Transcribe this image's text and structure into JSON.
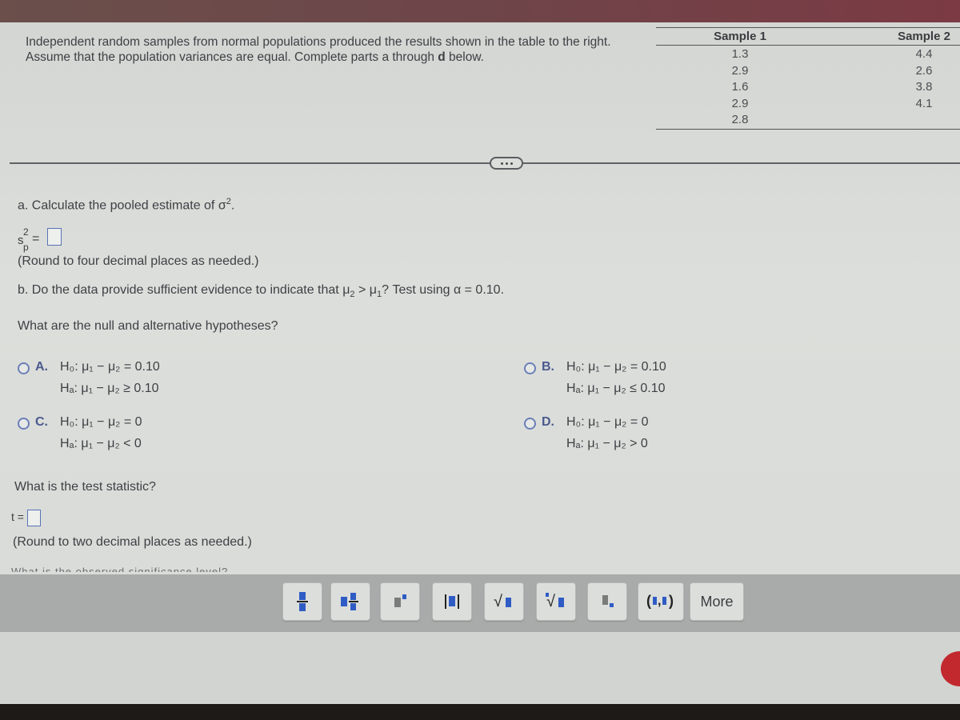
{
  "problem": {
    "line1": "Independent random samples from normal populations produced the results shown in the table to the right.",
    "line2_pre": "Assume that the population variances are equal. Complete parts a through ",
    "line2_bold": "d",
    "line2_post": " below."
  },
  "table": {
    "columns": [
      {
        "header": "Sample 1",
        "values": [
          "1.3",
          "2.9",
          "1.6",
          "2.9",
          "2.8"
        ]
      },
      {
        "header": "Sample 2",
        "values": [
          "4.4",
          "2.6",
          "3.8",
          "4.1"
        ]
      }
    ]
  },
  "part_a": {
    "prompt": "a. Calculate the pooled estimate of σ",
    "prompt_sup": "2",
    "prompt_end": ".",
    "answer_label_s": "s",
    "answer_label_sup": "2",
    "answer_label_sub": "p",
    "equals": "=",
    "answer_value": "",
    "hint": "(Round to four decimal places as needed.)"
  },
  "part_b": {
    "prompt_pre": "b. Do the data provide sufficient evidence to indicate that μ",
    "prompt_sub1": "2",
    "prompt_mid": " > μ",
    "prompt_sub2": "1",
    "prompt_post": "? Test using α = 0.10.",
    "hypotheses_question": "What are the null and alternative hypotheses?",
    "options": [
      {
        "letter": "A.",
        "h0": "H₀: μ₁ − μ₂ = 0.10",
        "ha": "Hₐ: μ₁ − μ₂ ≥ 0.10",
        "selected": false
      },
      {
        "letter": "B.",
        "h0": "H₀: μ₁ − μ₂ = 0.10",
        "ha": "Hₐ: μ₁ − μ₂ ≤ 0.10",
        "selected": false
      },
      {
        "letter": "C.",
        "h0": "H₀: μ₁ − μ₂ = 0",
        "ha": "Hₐ: μ₁ − μ₂ < 0",
        "selected": false
      },
      {
        "letter": "D.",
        "h0": "H₀: μ₁ − μ₂ = 0",
        "ha": "Hₐ: μ₁ − μ₂ > 0",
        "selected": false
      }
    ],
    "test_stat_question": "What is the test statistic?",
    "t_label": "t =",
    "t_value": "",
    "t_hint": "(Round to two decimal places as needed.)",
    "next_question_partial": "What is the observed significance level?"
  },
  "toolbar": {
    "buttons": [
      {
        "icon": "fraction-icon"
      },
      {
        "icon": "mixed-number-icon"
      },
      {
        "icon": "exponent-icon"
      },
      {
        "icon": "absolute-value-icon"
      },
      {
        "icon": "square-root-icon"
      },
      {
        "icon": "nth-root-icon"
      },
      {
        "icon": "subscript-icon"
      },
      {
        "icon": "ordered-pair-icon"
      }
    ],
    "more_label": "More"
  },
  "colors": {
    "accent_blue": "#2f5cc4",
    "radio_border": "#6a7fb8",
    "record_red": "#c1292f"
  }
}
